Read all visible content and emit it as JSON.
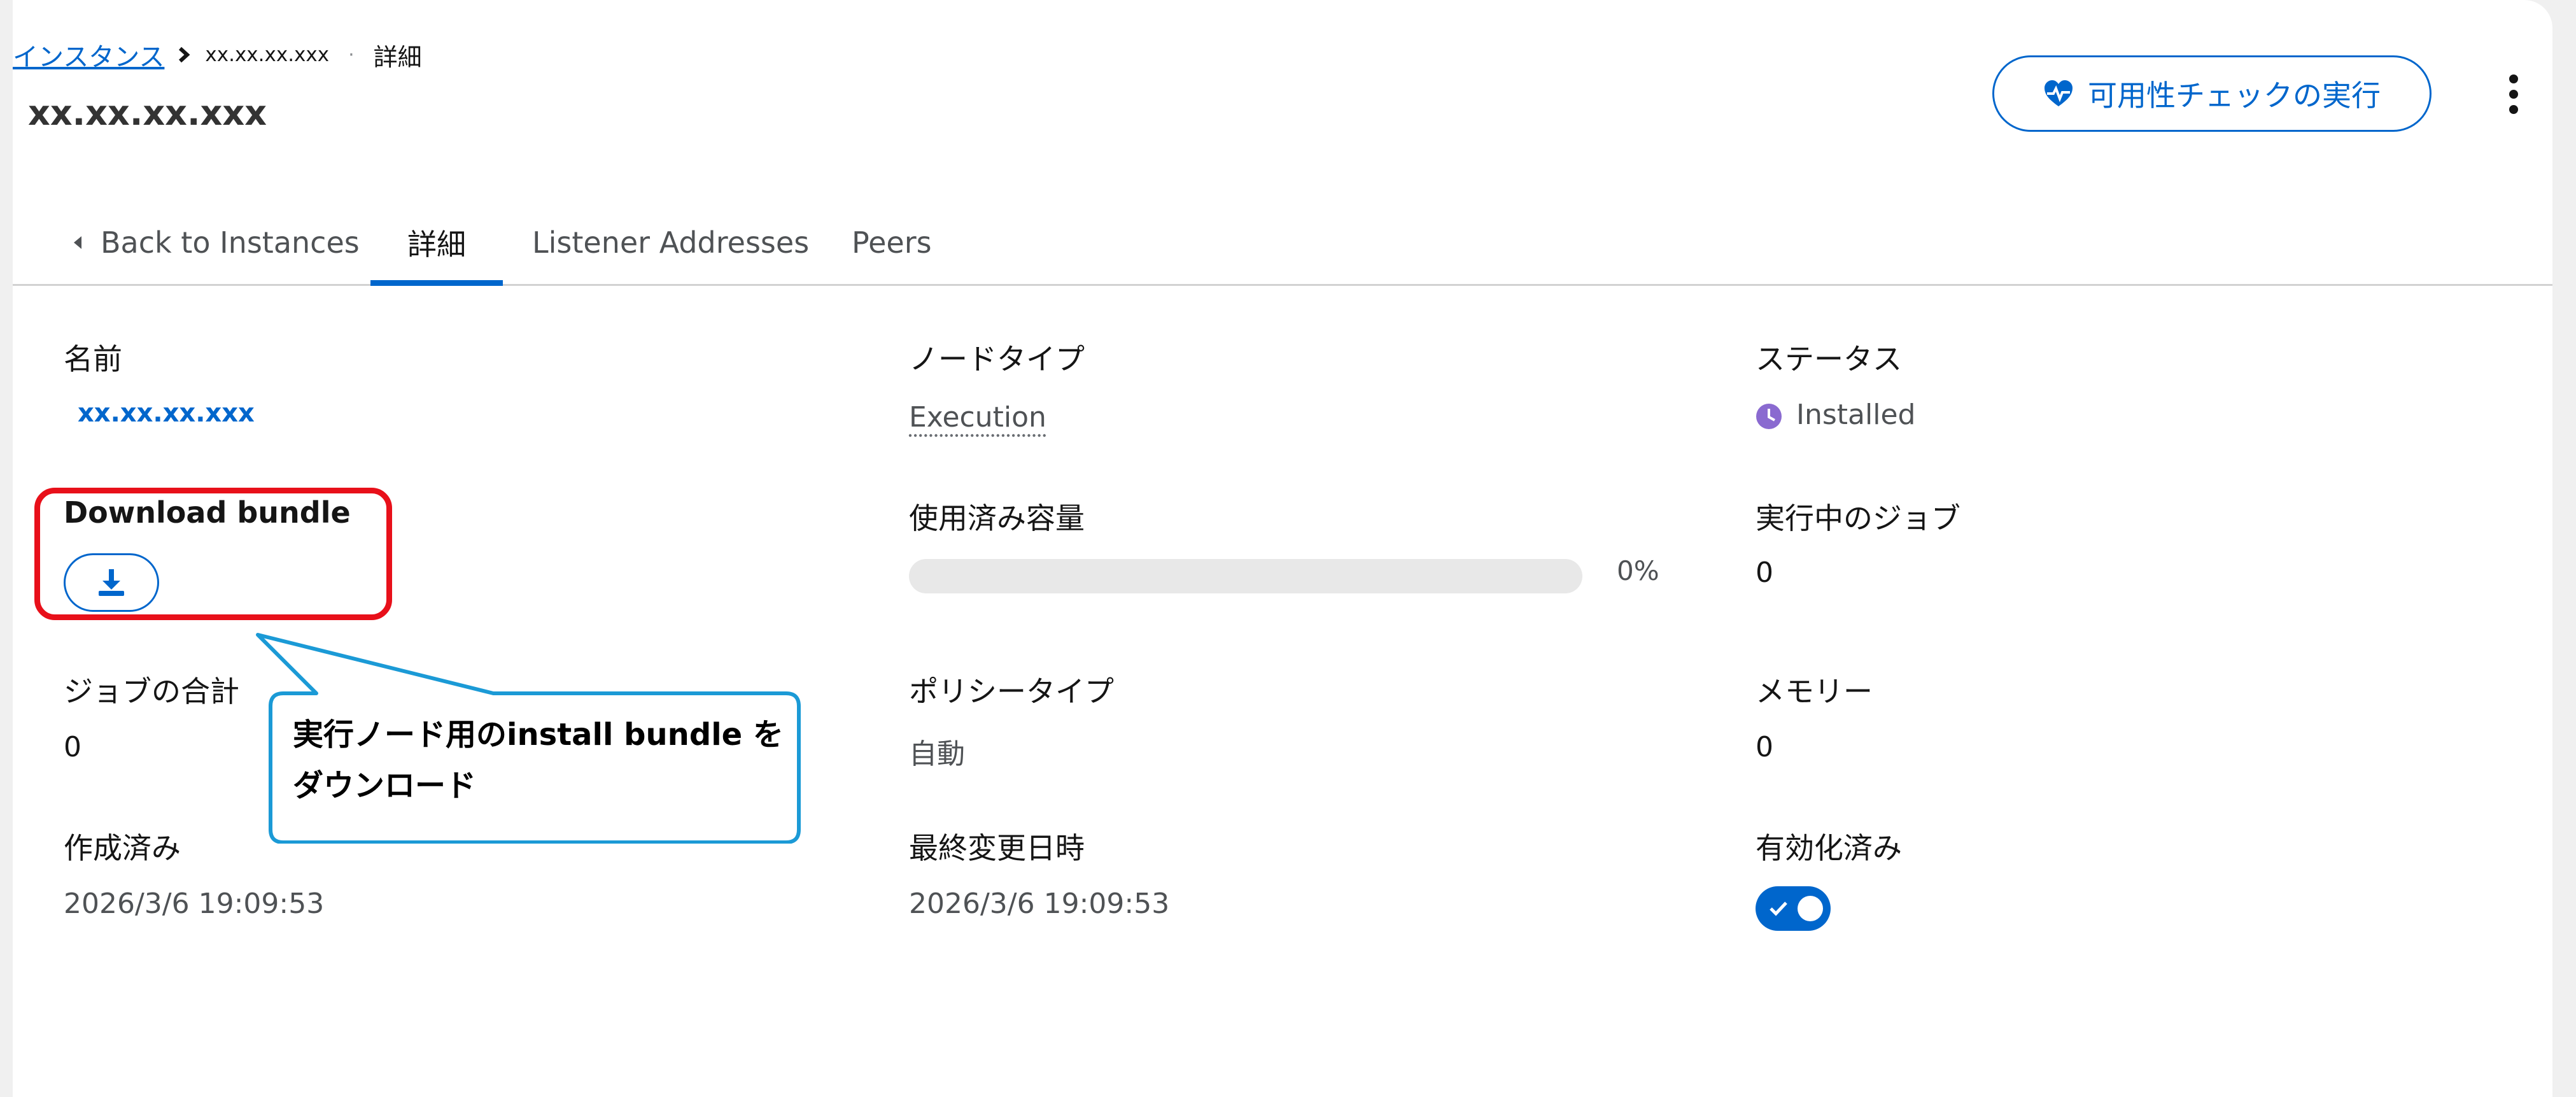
{
  "breadcrumb": {
    "link": "インスタンス",
    "item": "xx.xx.xx.xxx",
    "current": "詳細"
  },
  "page_title": "xx.xx.xx.xxx",
  "health_check_button": "可用性チェックの実行",
  "tabs": {
    "back": "Back to Instances",
    "details": "詳細",
    "listener_addresses": "Listener Addresses",
    "peers": "Peers"
  },
  "details": {
    "name_label": "名前",
    "name_value": "xx.xx.xx.xxx",
    "node_type_label": "ノードタイプ",
    "node_type_value": "Execution",
    "status_label": "ステータス",
    "status_value": "Installed",
    "download_bundle_label": "Download bundle",
    "used_capacity_label": "使用済み容量",
    "used_capacity_value": "0%",
    "used_capacity_percent": 0,
    "running_jobs_label": "実行中のジョブ",
    "running_jobs_value": "0",
    "total_jobs_label": "ジョブの合計",
    "total_jobs_value": "0",
    "policy_type_label": "ポリシータイプ",
    "policy_type_value": "自動",
    "memory_label": "メモリー",
    "memory_value": "0",
    "created_label": "作成済み",
    "created_value": "2026/3/6 19:09:53",
    "modified_label": "最終変更日時",
    "modified_value": "2026/3/6 19:09:53",
    "enabled_label": "有効化済み",
    "enabled_value": true
  },
  "annotation": {
    "line1": "実行ノード用のinstall bundle を",
    "line2": "ダウンロード"
  },
  "colors": {
    "accent": "#0066cc",
    "status_icon": "#8a6ad0",
    "highlight": "#e8101a",
    "callout_border": "#1b9ad6"
  },
  "icons": {
    "health_check": "heartbeat-icon",
    "more": "kebab-icon",
    "back": "caret-left-icon",
    "status": "clock-icon",
    "download": "download-icon",
    "toggle": "check-icon"
  }
}
